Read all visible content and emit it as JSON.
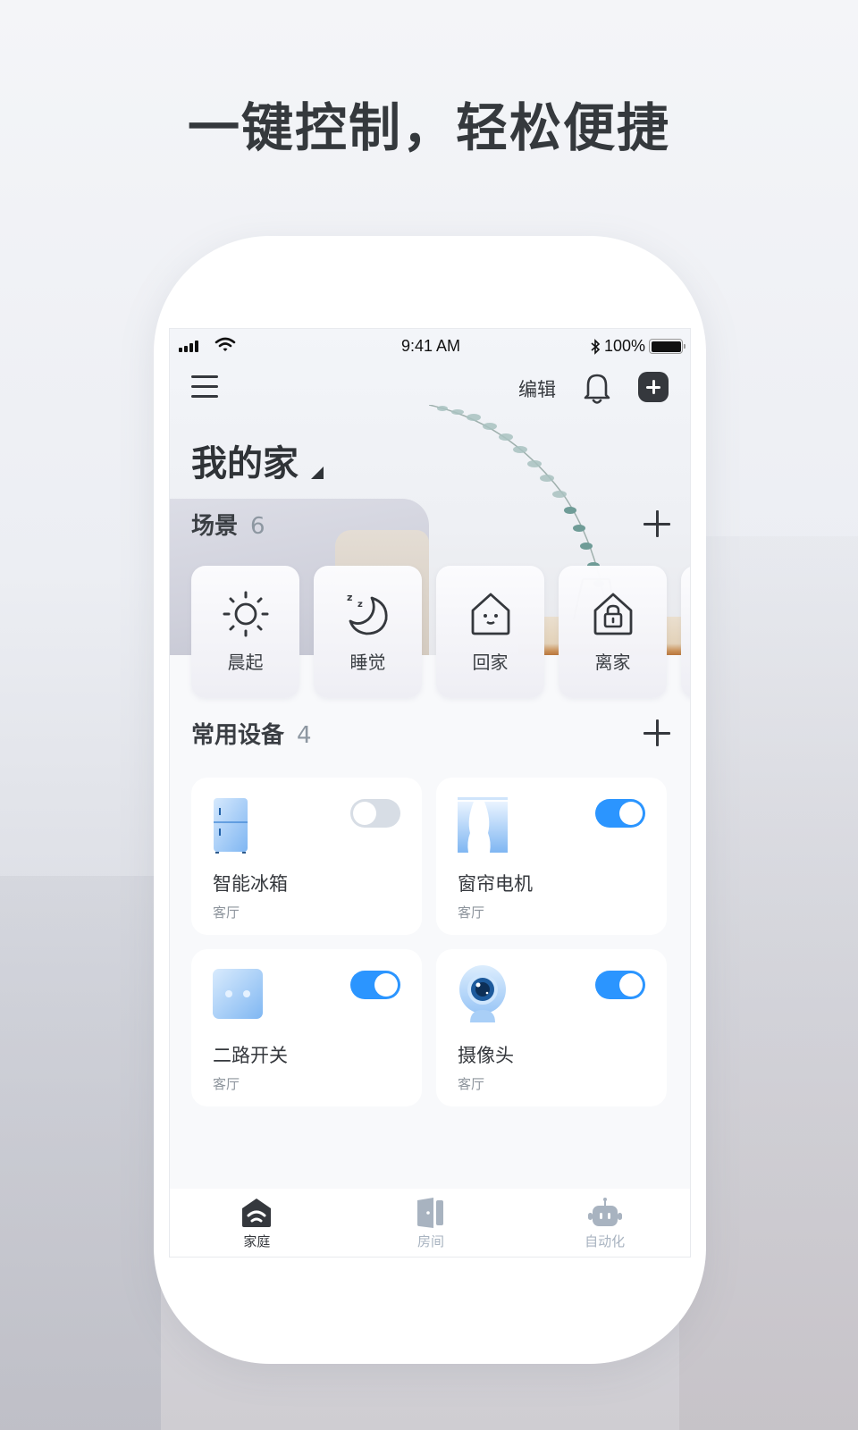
{
  "headline": "一键控制，轻松便捷",
  "status_bar": {
    "time": "9:41 AM",
    "battery": "100%"
  },
  "topbar": {
    "edit_label": "编辑",
    "icons": [
      "menu-icon",
      "bell-icon",
      "plus-icon"
    ]
  },
  "home": {
    "title": "我的家"
  },
  "scenes": {
    "title": "场景",
    "count": "6",
    "items": [
      {
        "label": "晨起",
        "icon": "sun-icon"
      },
      {
        "label": "睡觉",
        "icon": "moon-sleep-icon"
      },
      {
        "label": "回家",
        "icon": "home-smile-icon"
      },
      {
        "label": "离家",
        "icon": "home-lock-icon"
      }
    ]
  },
  "devices": {
    "title": "常用设备",
    "count": "4",
    "items": [
      {
        "name": "智能冰箱",
        "room": "客厅",
        "icon": "fridge-icon",
        "on": false
      },
      {
        "name": "窗帘电机",
        "room": "客厅",
        "icon": "curtain-icon",
        "on": true
      },
      {
        "name": "二路开关",
        "room": "客厅",
        "icon": "switch-icon",
        "on": true
      },
      {
        "name": "摄像头",
        "room": "客厅",
        "icon": "camera-icon",
        "on": true
      }
    ]
  },
  "tabbar": {
    "items": [
      {
        "label": "家庭",
        "icon": "home-tab-icon",
        "active": true
      },
      {
        "label": "房间",
        "icon": "door-icon",
        "active": false
      },
      {
        "label": "自动化",
        "icon": "robot-icon",
        "active": false
      }
    ]
  },
  "colors": {
    "accent": "#2b95ff",
    "toggle_off": "#d7dde5",
    "text_primary": "#35383d",
    "text_secondary": "#8e959d",
    "tab_inactive": "#a8b3c0"
  }
}
